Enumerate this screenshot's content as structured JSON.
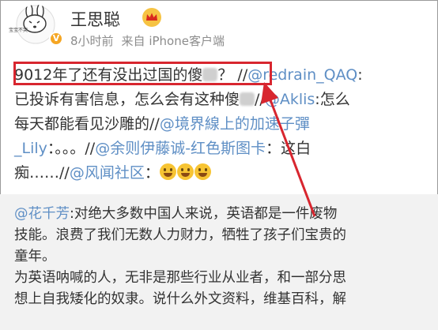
{
  "user": {
    "name": "王思聪",
    "time": "8小时前",
    "source": "来自 iPhone客户端",
    "verified_badge": "V",
    "avatar_caption": "宝宝不哭"
  },
  "post": {
    "l1_a": "9012年了还有没出过国的傻",
    "l1_b": "？",
    "l1_c": " //",
    "l1_mention": "@redrain_QAQ",
    "l1_d": ":",
    "l2_a": "已投诉有害信息，怎么会有这种傻",
    "l2_b": "//",
    "l2_mention": "@Aklis",
    "l2_c": ":怎么",
    "l3_a": "每天都能看见沙雕的//",
    "l3_mention": "@境界線上的加速子彈",
    "l4_mention": "_Lily",
    "l4_a": "：。。。//",
    "l4_mention2": "@余则伊藤诚-红色斯图卡",
    "l4_b": "：这白",
    "l5_a": "痴……//",
    "l5_mention": "@风闻社区",
    "l5_b": "："
  },
  "quote": {
    "mention": "@花千芳",
    "lines": [
      ":对绝大多数中国人来说，英语都是一件废物",
      "技能。浪费了我们无数人力财力，牺牲了孩子们宝贵的",
      "童年。",
      "为英语呐喊的人，无非是那些行业从业者，和一部分思",
      "想上自我矮化的奴隶。说什么外文资料，维基百科，解"
    ]
  },
  "colors": {
    "mention": "#5f8fc5",
    "highlight": "#d8262f",
    "quote_bg": "#f2f2f2"
  },
  "icons": [
    "avatar-icon",
    "verified-icon",
    "crown-icon",
    "laugh-emoji-icon"
  ]
}
